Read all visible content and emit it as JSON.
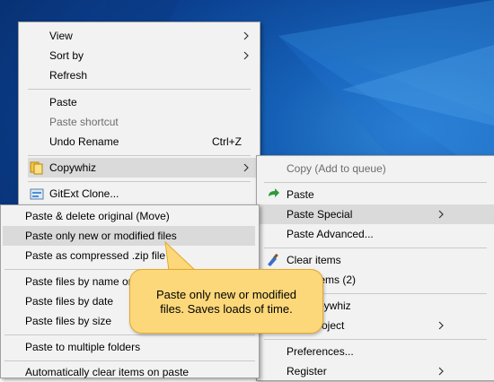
{
  "desktop_menu": {
    "items": [
      {
        "label": "View"
      },
      {
        "label": "Sort by"
      },
      {
        "label": "Refresh"
      },
      {
        "label": "Paste"
      },
      {
        "label": "Paste shortcut"
      },
      {
        "label": "Undo Rename",
        "shortcut": "Ctrl+Z"
      },
      {
        "label": "Copywhiz"
      },
      {
        "label": "GitExt Clone..."
      }
    ]
  },
  "copywhiz_menu": {
    "items": [
      {
        "label": "Copy (Add to queue)"
      },
      {
        "label": "Paste"
      },
      {
        "label": "Paste Special"
      },
      {
        "label": "Paste Advanced..."
      },
      {
        "label": "Clear items"
      },
      {
        "label": "...tems (2)"
      },
      {
        "label": "...pywhiz"
      },
      {
        "label": "...roject"
      },
      {
        "label": "Preferences..."
      },
      {
        "label": "Register"
      }
    ]
  },
  "paste_special_menu": {
    "items": [
      {
        "label": "Paste & delete original (Move)"
      },
      {
        "label": "Paste only new or modified files"
      },
      {
        "label": "Paste as compressed .zip file"
      },
      {
        "label": "Paste files by name or"
      },
      {
        "label": "Paste files by date"
      },
      {
        "label": "Paste files by size"
      },
      {
        "label": "Paste to multiple folders"
      },
      {
        "label": "Automatically clear items on paste"
      }
    ]
  },
  "tooltip": {
    "line1": "Paste only new or modified",
    "line2": "files. Saves loads of time."
  },
  "colors": {
    "menu_bg": "#f2f2f2",
    "highlight": "#dadada",
    "tooltip_bg": "#fcd87a",
    "desktop": "#0b3f8f"
  }
}
